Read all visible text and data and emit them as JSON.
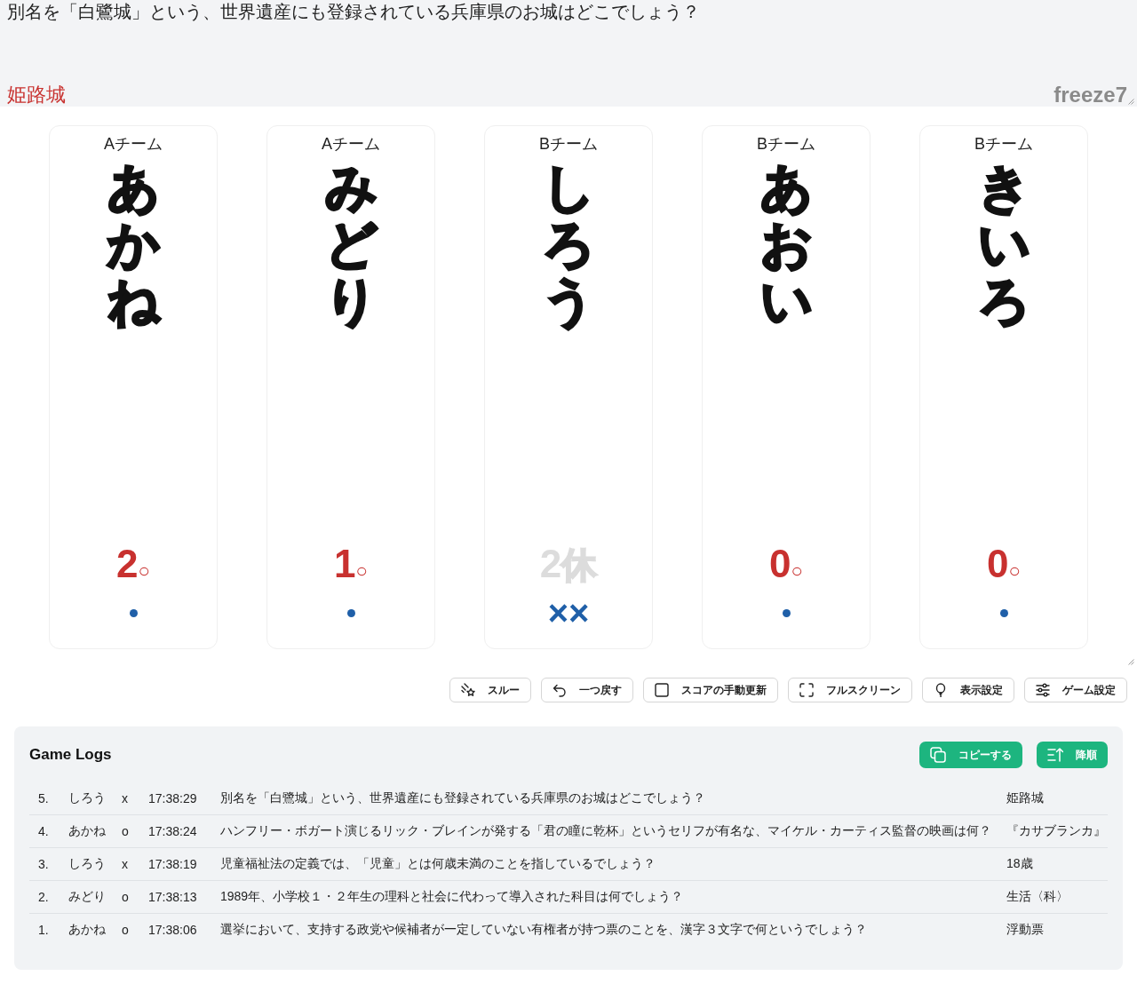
{
  "question": {
    "text": "別名を「白鷺城」という、世界遺産にも登録されている兵庫県のお城はどこでしょう？",
    "answer": "姫路城",
    "room": "freeze7"
  },
  "players": [
    {
      "team": "Aチーム",
      "name": "あかね",
      "score": "2",
      "suffix": "○",
      "resting": false
    },
    {
      "team": "Aチーム",
      "name": "みどり",
      "score": "1",
      "suffix": "○",
      "resting": false
    },
    {
      "team": "Bチーム",
      "name": "しろう",
      "score": "2",
      "suffix": "休",
      "resting": true,
      "misses": "××"
    },
    {
      "team": "Bチーム",
      "name": "あおい",
      "score": "0",
      "suffix": "○",
      "resting": false
    },
    {
      "team": "Bチーム",
      "name": "きいろ",
      "score": "0",
      "suffix": "○",
      "resting": false
    }
  ],
  "toolbar": [
    {
      "label": "スルー"
    },
    {
      "label": "一つ戻す"
    },
    {
      "label": "スコアの手動更新"
    },
    {
      "label": "フルスクリーン"
    },
    {
      "label": "表示設定"
    },
    {
      "label": "ゲーム設定"
    }
  ],
  "logs": {
    "title": "Game Logs",
    "buttons": [
      {
        "label": "コピーする"
      },
      {
        "label": "降順"
      }
    ],
    "entries": [
      {
        "number": "5.",
        "player": "しろう",
        "result": "x",
        "time": "17:38:29",
        "question": "別名を「白鷺城」という、世界遺産にも登録されている兵庫県のお城はどこでしょう？",
        "answer": "姫路城"
      },
      {
        "number": "4.",
        "player": "あかね",
        "result": "o",
        "time": "17:38:24",
        "question": "ハンフリー・ボガート演じるリック・ブレインが発する「君の瞳に乾杯」というセリフが有名な、マイケル・カーティス監督の映画は何？",
        "answer": "『カサブランカ』"
      },
      {
        "number": "3.",
        "player": "しろう",
        "result": "x",
        "time": "17:38:19",
        "question": "児童福祉法の定義では、「児童」とは何歳未満のことを指しているでしょう？",
        "answer": "18歳"
      },
      {
        "number": "2.",
        "player": "みどり",
        "result": "o",
        "time": "17:38:13",
        "question": "1989年、小学校１・２年生の理科と社会に代わって導入された科目は何でしょう？",
        "answer": "生活〈科〉"
      },
      {
        "number": "1.",
        "player": "あかね",
        "result": "o",
        "time": "17:38:06",
        "question": "選挙において、支持する政党や候補者が一定していない有権者が持つ票のことを、漢字３文字で何というでしょう？",
        "answer": "浮動票"
      }
    ]
  }
}
